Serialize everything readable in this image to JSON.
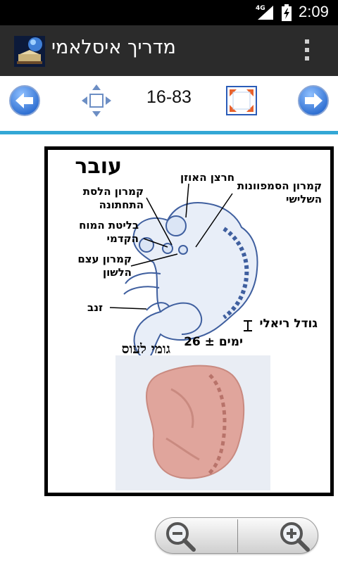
{
  "status_bar": {
    "network": "4G",
    "time": "2:09"
  },
  "action_bar": {
    "title": "מדריך איסלאמי",
    "icons": [
      "app-logo-icon",
      "overflow-menu-icon"
    ]
  },
  "navigation": {
    "page_indicator": "16-83",
    "icons": [
      "arrow-left-icon",
      "move-icon",
      "fullscreen-icon",
      "arrow-right-icon"
    ]
  },
  "figure": {
    "title": "עובר",
    "labels": {
      "ear_groove": "חרצן האוזן",
      "third_arch": [
        "קמרון הסמפוונות",
        "השלישי"
      ],
      "lower_jaw": [
        "קמרון הלסת",
        "התחתונה"
      ],
      "forebrain": [
        "בליטת המוח",
        "הקדמי"
      ],
      "hyoid": [
        "קמרון עצם",
        "הלשון"
      ],
      "tail": "זנב",
      "real_size": "גודל ריאלי",
      "days": "ימים ± 26",
      "chewed_gum": "גומי לעוס"
    },
    "colors": {
      "embryo_outline": "#3f5f9f",
      "embryo_fill": "#e8eef8",
      "gum": "#e0a59c"
    }
  },
  "zoom": {
    "icons": [
      "zoom-out-icon",
      "zoom-in-icon"
    ]
  },
  "colors": {
    "status_bar": "#000000",
    "action_bar": "#2b2b2b",
    "divider": "#33a7d5",
    "nav_arrow": "#2c6fd4"
  }
}
